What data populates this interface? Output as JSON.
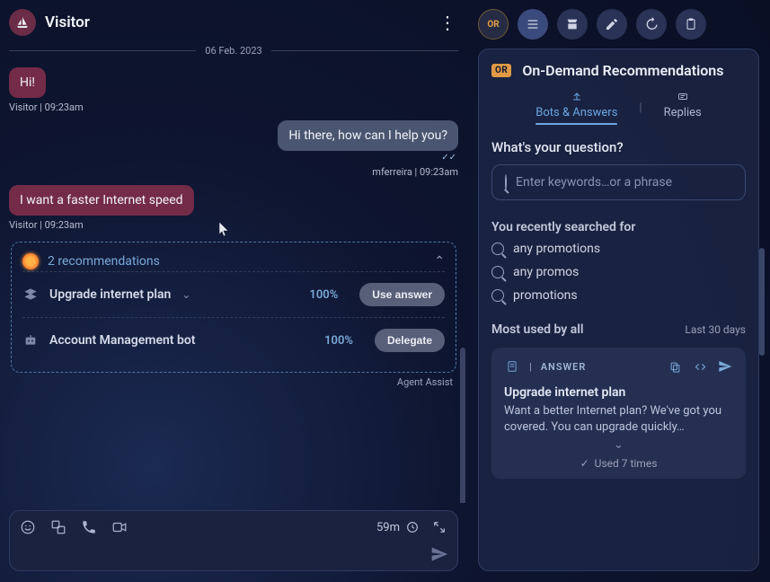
{
  "header": {
    "title": "Visitor"
  },
  "chat": {
    "date": "06 Feb. 2023",
    "messages": [
      {
        "who": "visitor",
        "text": "Hi!",
        "meta": "Visitor  |  09:23am"
      },
      {
        "who": "agent",
        "text": "Hi there, how can I help you?",
        "meta": "mferreira  |  09:23am"
      },
      {
        "who": "visitor",
        "text": "I want a faster Internet speed",
        "meta": "Visitor  |  09:23am"
      }
    ]
  },
  "recommendations": {
    "heading": "2 recommendations",
    "items": [
      {
        "name": "Upgrade internet plan",
        "score": "100%",
        "action": "Use answer",
        "icon": "stack"
      },
      {
        "name": "Account Management bot",
        "score": "100%",
        "action": "Delegate",
        "icon": "bot"
      }
    ],
    "footer": "Agent Assist"
  },
  "composer": {
    "timer": "59m"
  },
  "sidepanel": {
    "toolbar_badge": "OR",
    "title_badge": "OR",
    "title": "On-Demand Recommendations",
    "tabs": {
      "active": "Bots & Answers",
      "other": "Replies"
    },
    "question_heading": "What's your question?",
    "search_placeholder": "Enter keywords…or a phrase",
    "recent_title": "You recently searched for",
    "recent": [
      "any promotions",
      "any promos",
      "promotions"
    ],
    "most_used_title": "Most used by all",
    "most_used_range": "Last 30 days",
    "answer": {
      "label": "ANSWER",
      "title": "Upgrade internet plan",
      "body": "Want a better Internet plan? We've got you covered. You can upgrade quickly…",
      "used": "Used 7 times"
    }
  }
}
